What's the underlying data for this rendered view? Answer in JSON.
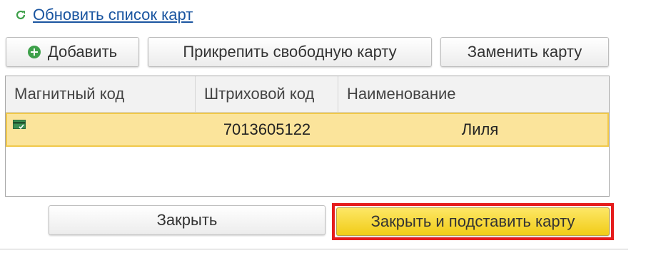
{
  "refresh": {
    "label": "Обновить список карт",
    "icon": "refresh-icon",
    "color": "#3ea04a"
  },
  "toolbar": {
    "add_label": "Добавить",
    "add_icon": "add-icon",
    "attach_label": "Прикрепить свободную карту",
    "replace_label": "Заменить карту"
  },
  "table": {
    "columns": [
      "Магнитный код",
      "Штриховой код",
      "Наименование"
    ],
    "rows": [
      {
        "icon": "card-icon",
        "magnetic_code": "",
        "barcode": "7013605122",
        "name": "Лиля",
        "selected": true
      }
    ],
    "selection_color": "#fbe49b"
  },
  "footer": {
    "close_label": "Закрыть",
    "close_insert_label": "Закрыть и подставить карту",
    "highlight_color": "#e51c1c",
    "primary_color": "#f5d530"
  }
}
